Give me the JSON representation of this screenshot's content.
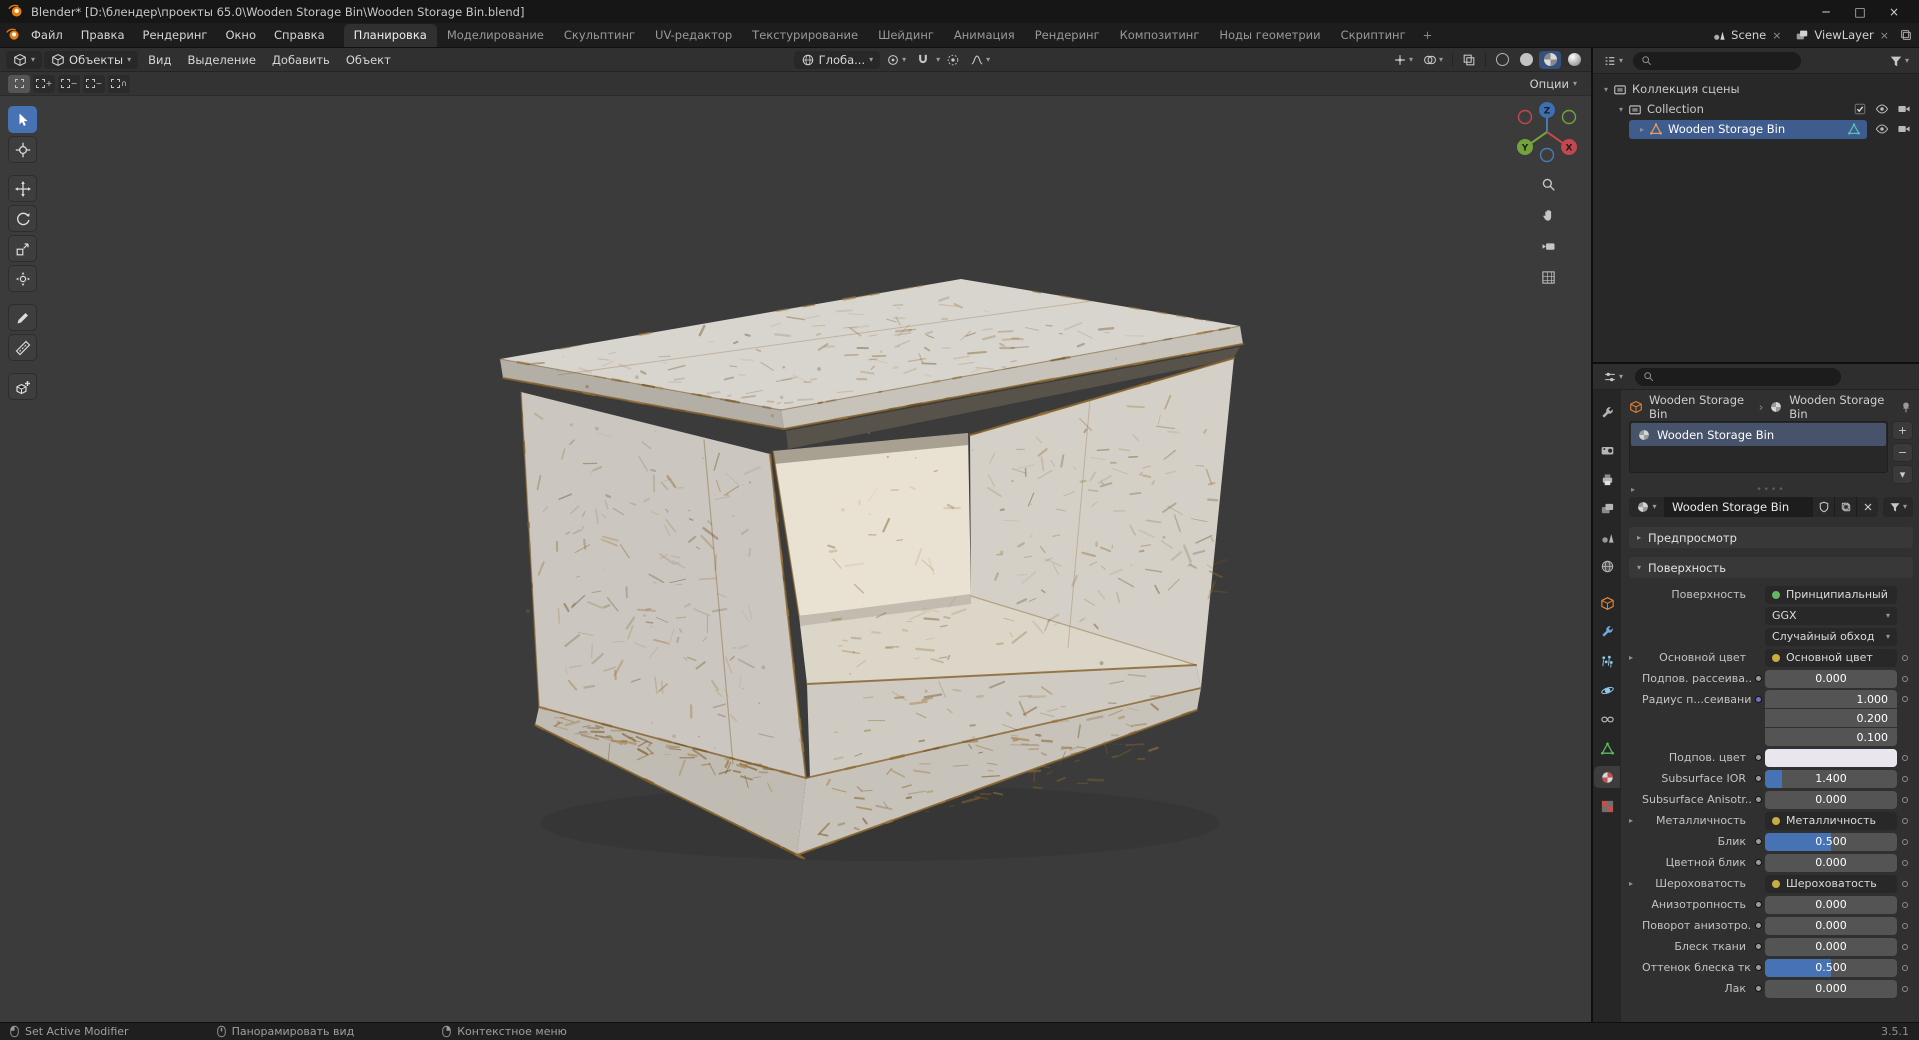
{
  "window": {
    "title": "Blender* [D:\\блендер\\проекты 65.0\\Wooden Storage Bin\\Wooden Storage Bin.blend]"
  },
  "topbar": {
    "menus": [
      "Файл",
      "Правка",
      "Рендеринг",
      "Окно",
      "Справка"
    ],
    "workspaces": [
      "Планировка",
      "Моделирование",
      "Скульптинг",
      "UV-редактор",
      "Текстурирование",
      "Шейдинг",
      "Анимация",
      "Рендеринг",
      "Композитинг",
      "Ноды геометрии",
      "Скриптинг"
    ],
    "active_workspace": "Планировка",
    "add_workspace": "+",
    "scene_label": "Scene",
    "view_layer_label": "ViewLayer"
  },
  "viewport": {
    "mode": "Объекты",
    "menus": [
      "Вид",
      "Выделение",
      "Добавить",
      "Объект"
    ],
    "orientation": "Глоба...",
    "options_label": "Опции",
    "select_modes": [
      "set",
      "extend",
      "subtract",
      "invert",
      "intersect"
    ],
    "tools": [
      {
        "name": "box-select",
        "active": true
      },
      {
        "name": "cursor"
      },
      {
        "name": "move"
      },
      {
        "name": "rotate"
      },
      {
        "name": "scale"
      },
      {
        "name": "transform"
      },
      {
        "name": "annotate"
      },
      {
        "name": "measure"
      },
      {
        "name": "add-cube"
      }
    ],
    "gizmo_axes": [
      "Z",
      "Y",
      "X"
    ],
    "shading_modes": [
      "wireframe",
      "solid",
      "material-preview",
      "rendered"
    ],
    "active_shading": "material-preview"
  },
  "scene3d": {
    "object": "Wooden Storage Bin"
  },
  "outliner": {
    "rows": [
      {
        "label": "Коллекция сцены",
        "depth": 0,
        "icon": "scene-collection",
        "expanded": true,
        "toggles": []
      },
      {
        "label": "Collection",
        "depth": 1,
        "icon": "collection",
        "expanded": true,
        "toggles": [
          "checkbox",
          "eye",
          "camera"
        ]
      },
      {
        "label": "Wooden Storage Bin",
        "depth": 2,
        "icon": "mesh-object",
        "expanded": false,
        "selected": true,
        "badge": "mesh-data",
        "toggles": [
          "eye",
          "camera"
        ]
      }
    ]
  },
  "properties": {
    "tabs": [
      "tool",
      "render",
      "output",
      "view-layer",
      "scene",
      "world",
      "object",
      "modifiers",
      "particles",
      "physics",
      "constraints",
      "object-data",
      "material",
      "texture"
    ],
    "active_tab": "material",
    "breadcrumb": [
      "Wooden Storage Bin",
      "Wooden Storage Bin"
    ],
    "slots": [
      {
        "name": "Wooden Storage Bin",
        "selected": true
      }
    ],
    "datablock": {
      "name": "Wooden Storage Bin"
    },
    "panels": {
      "preview": "Предпросмотр",
      "surface": "Поверхность"
    },
    "surface_rows": [
      {
        "label": "Поверхность",
        "type": "menu",
        "value": "Принципиальный BSDF",
        "dot": "#63b763"
      },
      {
        "label": "",
        "type": "dropdown",
        "value": "GGX"
      },
      {
        "label": "",
        "type": "dropdown",
        "value": "Случайный обход"
      },
      {
        "label": "Основной цвет",
        "type": "link",
        "value": "Основной цвет",
        "dot": "#c9ab41",
        "expander": true,
        "decorator": true
      },
      {
        "label": "Подпов. рассеива...",
        "type": "slider",
        "value": "0.000",
        "fill": 0,
        "socket": "#9a9a9a",
        "decorator": true
      },
      {
        "label": "Радиус п...сеивания",
        "type": "vector",
        "values": [
          "1.000",
          "0.200",
          "0.100"
        ],
        "socket": "#7070c8",
        "decorator": true
      },
      {
        "label": "Подпов. цвет",
        "type": "color",
        "swatch": "#e9e6f0",
        "socket": "#9a9a9a",
        "decorator": true
      },
      {
        "label": "Subsurface IOR",
        "type": "slider",
        "value": "1.400",
        "fill": 0.13,
        "socket": "#9a9a9a",
        "decorator": true
      },
      {
        "label": "Subsurface Anisotr...",
        "type": "slider",
        "value": "0.000",
        "fill": 0,
        "socket": "#9a9a9a",
        "decorator": true
      },
      {
        "label": "Металличность",
        "type": "link",
        "value": "Металличность",
        "dot": "#c9ab41",
        "expander": true,
        "decorator": true
      },
      {
        "label": "Блик",
        "type": "slider",
        "value": "0.500",
        "fill": 0.5,
        "socket": "#9a9a9a",
        "decorator": true
      },
      {
        "label": "Цветной блик",
        "type": "slider",
        "value": "0.000",
        "fill": 0,
        "socket": "#9a9a9a",
        "decorator": true
      },
      {
        "label": "Шероховатость",
        "type": "link",
        "value": "Шероховатость",
        "dot": "#c9ab41",
        "expander": true,
        "decorator": true
      },
      {
        "label": "Анизотропность",
        "type": "slider",
        "value": "0.000",
        "fill": 0,
        "socket": "#9a9a9a",
        "decorator": true
      },
      {
        "label": "Поворот анизотро...",
        "type": "slider",
        "value": "0.000",
        "fill": 0,
        "socket": "#9a9a9a",
        "decorator": true
      },
      {
        "label": "Блеск ткани",
        "type": "slider",
        "value": "0.000",
        "fill": 0,
        "socket": "#9a9a9a",
        "decorator": true
      },
      {
        "label": "Оттенок блеска тк...",
        "type": "slider",
        "value": "0.500",
        "fill": 0.5,
        "socket": "#9a9a9a",
        "decorator": true
      },
      {
        "label": "Лак",
        "type": "slider",
        "value": "0.000",
        "fill": 0,
        "socket": "#9a9a9a",
        "decorator": true
      }
    ]
  },
  "statusbar": {
    "hints": [
      {
        "button": "left",
        "label": "Set Active Modifier"
      },
      {
        "button": "middle",
        "label": "Панорамировать вид"
      },
      {
        "button": "right",
        "label": "Контекстное меню"
      }
    ],
    "version": "3.5.1"
  },
  "colors": {
    "accent": "#4772b3",
    "selection": "#3f5c8f",
    "wood_wear": "#8a6833"
  }
}
